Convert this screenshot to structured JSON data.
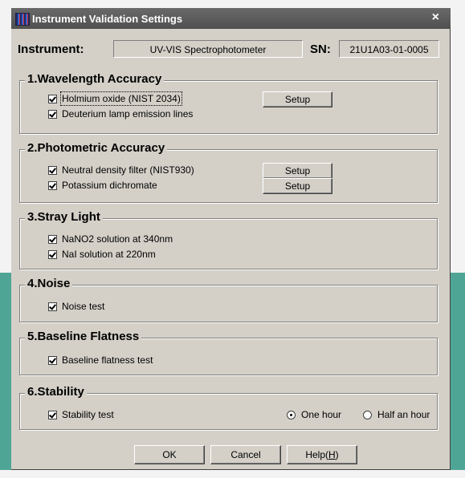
{
  "window": {
    "title": "Instrument Validation Settings",
    "close": "×"
  },
  "instrument": {
    "label": "Instrument:",
    "value": "UV-VIS Spectrophotometer",
    "sn_label": "SN:",
    "sn_value": "21U1A03-01-0005"
  },
  "groups": [
    {
      "title": "1.Wavelength Accuracy",
      "items": [
        {
          "label": "Holmium oxide (NIST 2034)",
          "checked": true,
          "button": "Setup"
        },
        {
          "label": "Deuterium lamp emission lines",
          "checked": true
        }
      ]
    },
    {
      "title": "2.Photometric Accuracy",
      "items": [
        {
          "label": "Neutral density filter (NIST930)",
          "checked": true,
          "button": "Setup"
        },
        {
          "label": "Potassium dichromate",
          "checked": true,
          "button": "Setup"
        }
      ]
    },
    {
      "title": "3.Stray Light",
      "items": [
        {
          "label": "NaNO2 solution at 340nm",
          "checked": true
        },
        {
          "label": "NaI solution at 220nm",
          "checked": true
        }
      ]
    },
    {
      "title": "4.Noise",
      "items": [
        {
          "label": "Noise test",
          "checked": true
        }
      ]
    },
    {
      "title": "5.Baseline Flatness",
      "items": [
        {
          "label": "Baseline flatness test",
          "checked": true
        }
      ]
    },
    {
      "title": "6.Stability",
      "items": [
        {
          "label": "Stability test",
          "checked": true
        }
      ],
      "radios": [
        {
          "label": "One hour",
          "selected": true
        },
        {
          "label": "Half an hour",
          "selected": false
        }
      ]
    }
  ],
  "buttons": {
    "ok": "OK",
    "cancel": "Cancel",
    "help_prefix": "Help(",
    "help_key": "H",
    "help_suffix": ")"
  },
  "colors": {
    "dialog_bg": "#d4d0c8",
    "titlebar": "#5a5a5a",
    "side_accent": "#4fa595"
  }
}
